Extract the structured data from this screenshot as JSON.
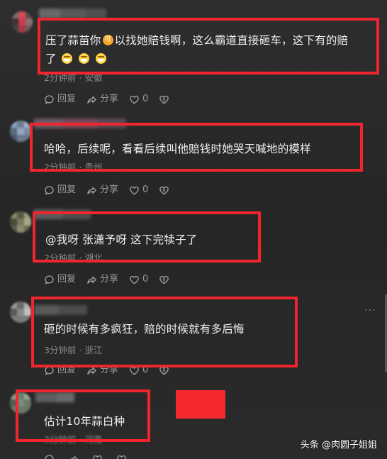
{
  "comments": [
    {
      "text_line1": "压了蒜苗你",
      "text_line1b": "以找她赔钱啊，这么霸道直接砸车，这下有的赔",
      "text_line2": "了",
      "meta": "2分钟前 · 安徽",
      "reply": "回复",
      "share": "分享",
      "likes": "0"
    },
    {
      "text": "哈哈，后续呢，看看后续叫他赔钱时她哭天喊地的模样",
      "meta": "2分钟前 · 贵州",
      "reply": "回复",
      "share": "分享",
      "likes": "0"
    },
    {
      "text": "@我呀 张潇予呀  这下完犊子了",
      "meta": "2分钟前 · 湖北",
      "reply": "回复",
      "share": "分享",
      "likes": "0"
    },
    {
      "text": "砸的时候有多疯狂，赔的时候就有多后悔",
      "meta": "3分钟前 · 浙江",
      "reply": "回复",
      "share": "分享",
      "likes": "0"
    },
    {
      "text": "估计10年蒜白种",
      "meta": "3分钟前 · 河南"
    }
  ],
  "more_options": "···",
  "watermark": "头条 @肉圆子姐姐",
  "colors": {
    "highlight_box": "#f0252d",
    "background": "#2b2b2b",
    "text": "#f2f2f2",
    "meta": "#8a8a8a"
  },
  "icons": [
    "comment-bubble-icon",
    "share-arrow-icon",
    "heart-icon",
    "broken-heart-icon",
    "emoji-ke-icon",
    "emoji-laugh-icon"
  ]
}
